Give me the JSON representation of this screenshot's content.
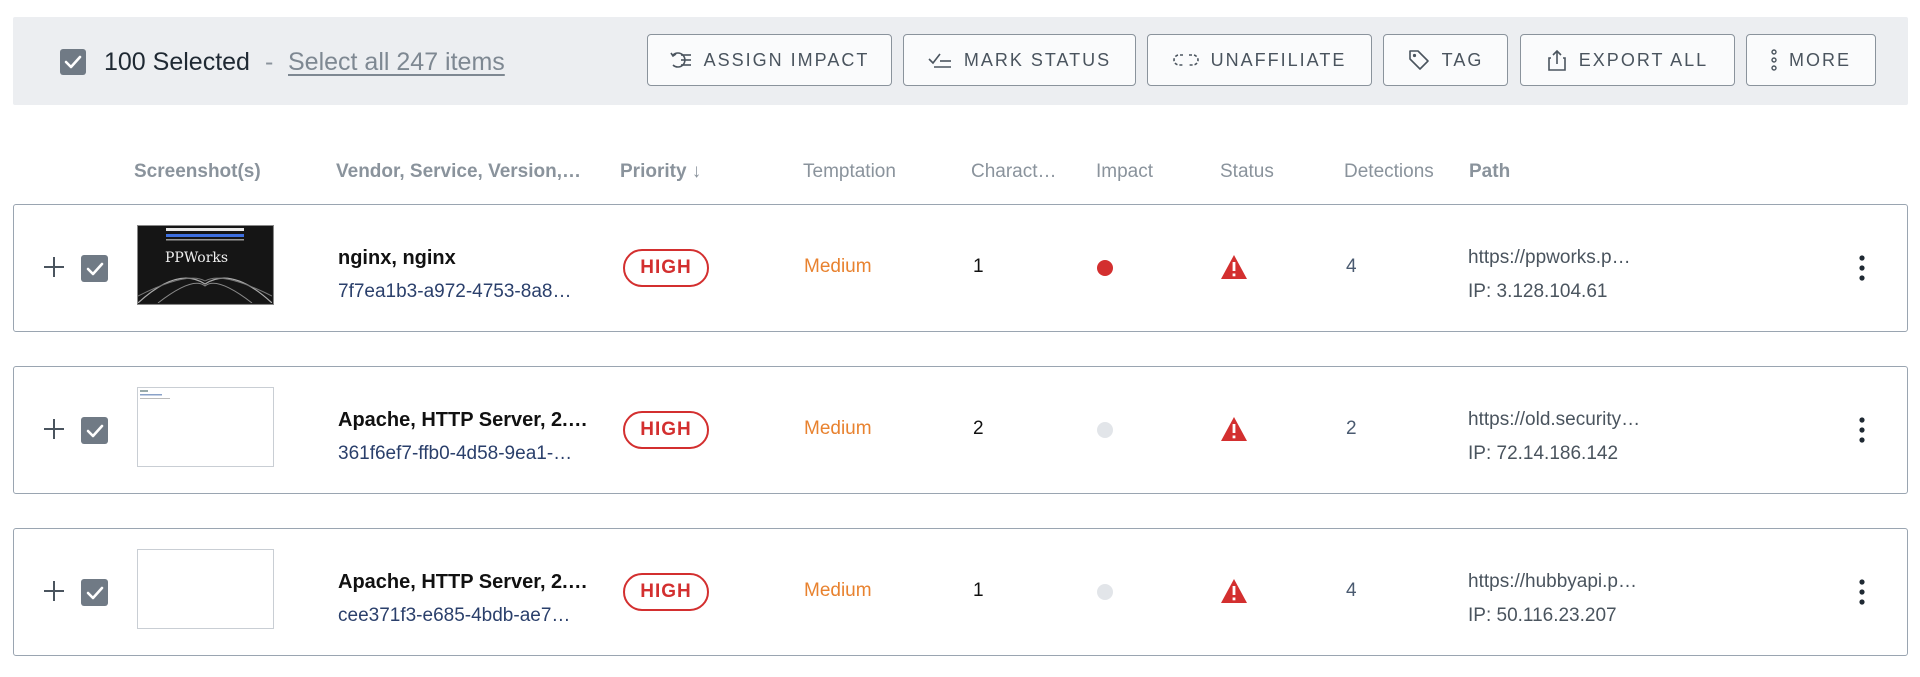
{
  "toolbar": {
    "selected_label": "100 Selected",
    "dash": "-",
    "select_all_label": "Select all 247 items",
    "buttons": [
      {
        "label": "ASSIGN IMPACT",
        "icon": "assign-impact-icon"
      },
      {
        "label": "MARK STATUS",
        "icon": "mark-status-icon"
      },
      {
        "label": "UNAFFILIATE",
        "icon": "unlink-icon"
      },
      {
        "label": "TAG",
        "icon": "tag-icon"
      },
      {
        "label": "EXPORT ALL",
        "icon": "export-icon"
      },
      {
        "label": "MORE",
        "icon": "vertical-dots-icon"
      }
    ]
  },
  "columns": {
    "screenshots": "Screenshot(s)",
    "vendor": "Vendor, Service, Version,…",
    "priority": "Priority ↓",
    "temptation": "Temptation",
    "charact": "Charact…",
    "impact": "Impact",
    "status": "Status",
    "detections": "Detections",
    "path": "Path"
  },
  "rows": [
    {
      "thumbnail_text": "PPWorks",
      "vendor": "nginx, nginx",
      "uuid": "7f7ea1b3-a972-4753-8a8…",
      "priority": "HIGH",
      "temptation": "Medium",
      "charact": "1",
      "impact_color": "#d32f2f",
      "status_icon": "warning-triangle-icon",
      "detections": "4",
      "path_url": "https://ppworks.p…",
      "path_ip": "IP: 3.128.104.61"
    },
    {
      "thumbnail_text": "",
      "vendor": "Apache, HTTP Server, 2.…",
      "uuid": "361f6ef7-ffb0-4d58-9ea1-…",
      "priority": "HIGH",
      "temptation": "Medium",
      "charact": "2",
      "impact_color": "#e2e5e9",
      "status_icon": "warning-triangle-icon",
      "detections": "2",
      "path_url": "https://old.security…",
      "path_ip": "IP: 72.14.186.142"
    },
    {
      "thumbnail_text": "",
      "vendor": "Apache, HTTP Server, 2.…",
      "uuid": "cee371f3-e685-4bdb-ae7…",
      "priority": "HIGH",
      "temptation": "Medium",
      "charact": "1",
      "impact_color": "#e2e5e9",
      "status_icon": "warning-triangle-icon",
      "detections": "4",
      "path_url": "https://hubbyapi.p…",
      "path_ip": "IP: 50.116.23.207"
    }
  ],
  "colors": {
    "toolbar_bg": "#eceef1",
    "checkbox": "#707a85",
    "priority_high": "#d32f2f",
    "temptation_medium": "#e8822f",
    "link_blue": "#2a3f6b"
  }
}
